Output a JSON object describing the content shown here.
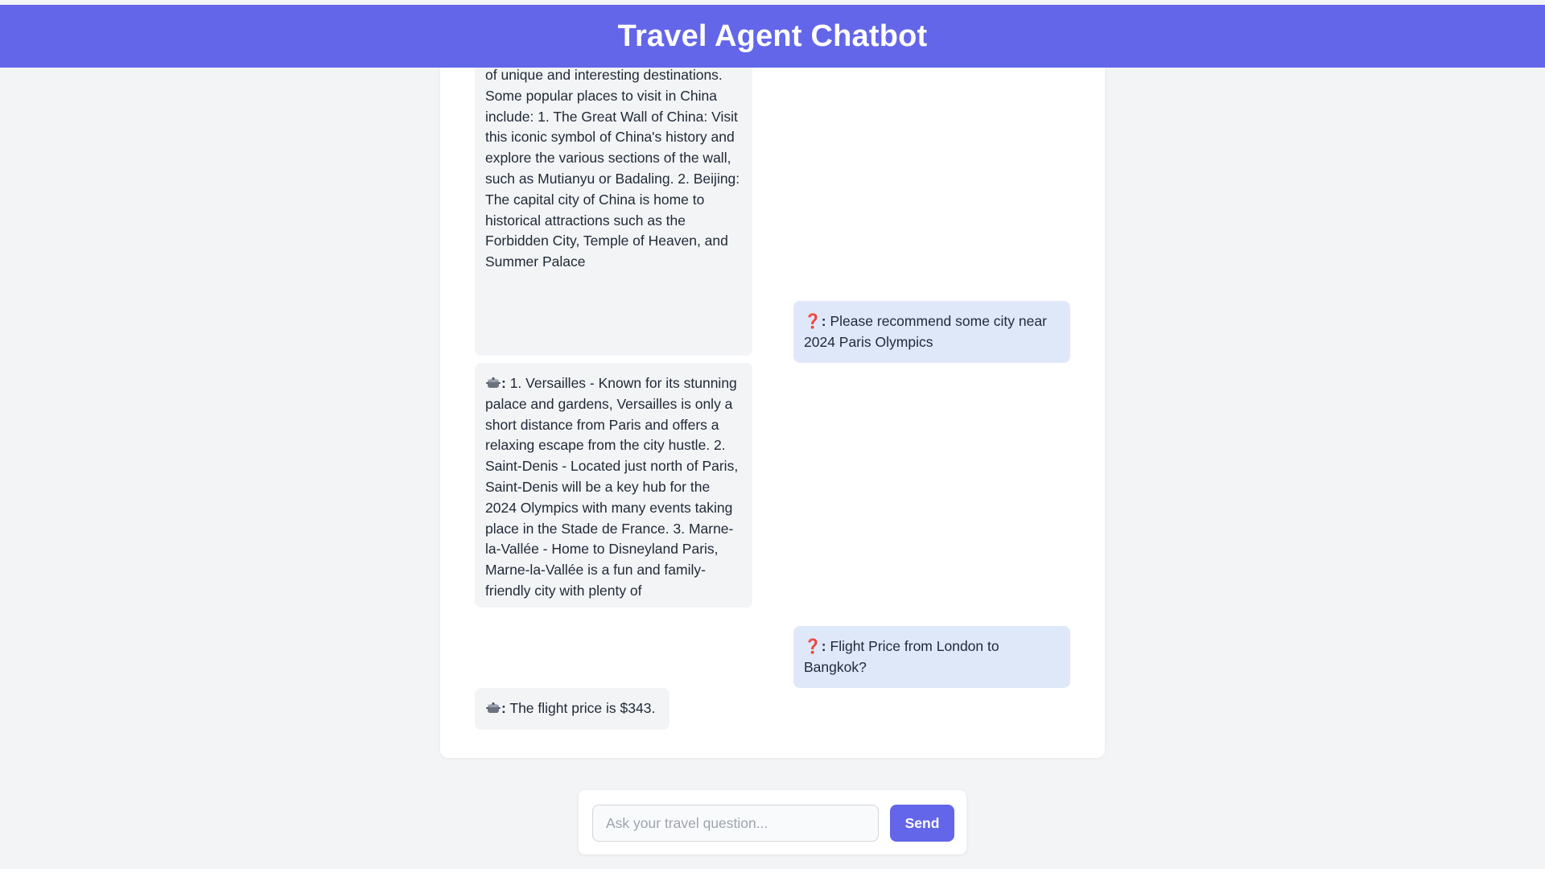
{
  "header": {
    "title": "Travel Agent Chatbot"
  },
  "messages": [
    {
      "role": "bot",
      "prefix": "",
      "text": "of unique and interesting destinations. Some popular places to visit in China include: 1. The Great Wall of China: Visit this iconic symbol of China's history and explore the various sections of the wall, such as Mutianyu or Badaling. 2. Beijing: The capital city of China is home to historical attractions such as the Forbidden City, Temple of Heaven, and Summer Palace"
    },
    {
      "role": "user",
      "prefix": ":",
      "text": "Please recommend some city near 2024 Paris Olympics"
    },
    {
      "role": "bot",
      "prefix": ":",
      "text": "1. Versailles - Known for its stunning palace and gardens, Versailles is only a short distance from Paris and offers a relaxing escape from the city hustle. 2. Saint-Denis - Located just north of Paris, Saint-Denis will be a key hub for the 2024 Olympics with many events taking place in the Stade de France. 3. Marne-la-Vallée - Home to Disneyland Paris, Marne-la-Vallée is a fun and family-friendly city with plenty of"
    },
    {
      "role": "user",
      "prefix": ":",
      "text": "Flight Price from London to Bangkok?"
    },
    {
      "role": "bot",
      "prefix": ":",
      "text": "The flight price is $343."
    }
  ],
  "icons": {
    "user": "question-mark-icon",
    "bot": "pot-icon"
  },
  "input": {
    "placeholder": "Ask your travel question...",
    "value": "",
    "send_label": "Send"
  },
  "colors": {
    "header_bg": "#6366e9",
    "send_bg": "#6366e9",
    "user_bubble": "#dfe8f9",
    "bot_bubble": "#f3f4f6"
  }
}
